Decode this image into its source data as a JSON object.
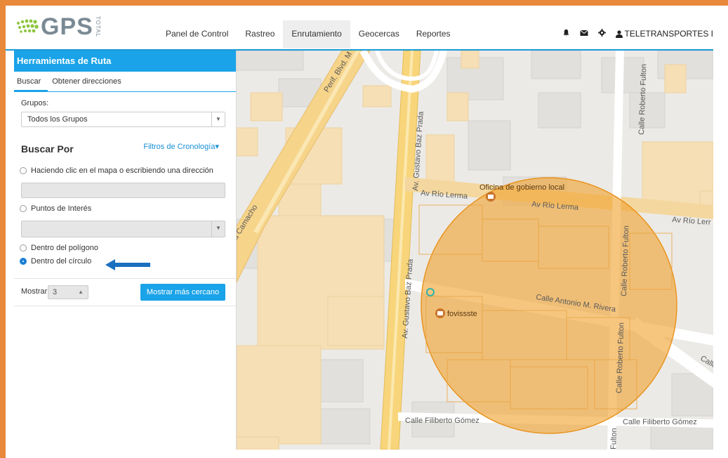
{
  "header": {
    "logo_text": "GPS",
    "logo_sub": "TOTAL",
    "nav": [
      "Panel de Control",
      "Rastreo",
      "Enrutamiento",
      "Geocercas",
      "Reportes"
    ],
    "user": "TELETRANSPORTES I"
  },
  "sidebar": {
    "title": "Herramientas de Ruta",
    "tabs": [
      "Buscar",
      "Obtener direcciones"
    ],
    "grupos_label": "Grupos:",
    "grupos_value": "Todos los Grupos",
    "buscar_por": "Buscar Por",
    "filtros": "Filtros de Cronología▾",
    "options": {
      "click_map": "Haciendo clic en el mapa o escribiendo una dirección",
      "poi": "Puntos de Interés",
      "polygon": "Dentro del polígono",
      "circle": "Dentro del círculo"
    },
    "mostrar_label": "Mostrar",
    "mostrar_value": "3",
    "btn_cercano": "Mostrar más cercano"
  },
  "map": {
    "labels": {
      "perif": "Perif. Blvd. M",
      "camacho": "a Camacho",
      "baz_prada_top": "Av. Gustavo Baz Prada",
      "baz_prada_mid": "Av. Gustavo Baz Prada",
      "rio_lerma_1": "Av Río Lerma",
      "rio_lerma_2": "Av Río Lerma",
      "rio_lerma_3": "Av Río Lerr",
      "oficina": "Oficina de gobierno local",
      "fovissste": "fovissste",
      "antonio": "Calle Antonio M. Rivera",
      "fulton_top": "Calle Roberto Fulton",
      "fulton_mid": "Calle Roberto Fulton",
      "fulton_bot": "Calle Roberto Fulton",
      "fulton_small": "Fulton",
      "filiberto_1": "Calle Filiberto Gómez",
      "filiberto_2": "Calle Filiberto Gómez",
      "calle_cut": "Calle"
    }
  },
  "colors": {
    "accent": "#1aa3e8",
    "frame": "#e8883a",
    "circle_fill": "#f0a330",
    "road_main": "#f8d57a"
  }
}
